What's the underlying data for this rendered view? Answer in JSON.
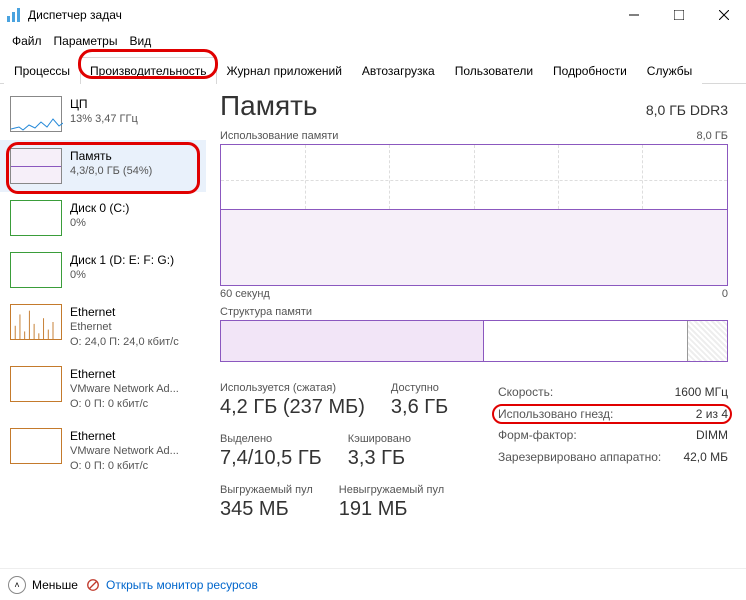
{
  "window": {
    "title": "Диспетчер задач"
  },
  "menu": {
    "file": "Файл",
    "options": "Параметры",
    "view": "Вид"
  },
  "tabs": {
    "processes": "Процессы",
    "performance": "Производительность",
    "apphistory": "Журнал приложений",
    "startup": "Автозагрузка",
    "users": "Пользователи",
    "details": "Подробности",
    "services": "Службы"
  },
  "sidebar": {
    "cpu": {
      "title": "ЦП",
      "detail": "13%  3,47 ГГц"
    },
    "memory": {
      "title": "Память",
      "detail": "4,3/8,0 ГБ (54%)"
    },
    "disk0": {
      "title": "Диск 0 (C:)",
      "detail": "0%"
    },
    "disk1": {
      "title": "Диск 1 (D: E: F: G:)",
      "detail": "0%"
    },
    "eth0": {
      "title": "Ethernet",
      "sub": "Ethernet",
      "detail": "О: 24,0 П: 24,0 кбит/с"
    },
    "eth1": {
      "title": "Ethernet",
      "sub": "VMware Network Ad...",
      "detail": "О: 0 П: 0 кбит/с"
    },
    "eth2": {
      "title": "Ethernet",
      "sub": "VMware Network Ad...",
      "detail": "О: 0 П: 0 кбит/с"
    }
  },
  "main": {
    "title": "Память",
    "spec": "8,0 ГБ DDR3",
    "usage_label": "Использование памяти",
    "usage_max": "8,0 ГБ",
    "x_left": "60 секунд",
    "x_right": "0",
    "comp_label": "Структура памяти",
    "stats": {
      "in_use_label": "Используется (сжатая)",
      "in_use": "4,2 ГБ (237 МБ)",
      "avail_label": "Доступно",
      "avail": "3,6 ГБ",
      "commit_label": "Выделено",
      "commit": "7,4/10,5 ГБ",
      "cached_label": "Кэшировано",
      "cached": "3,3 ГБ",
      "paged_label": "Выгружаемый пул",
      "paged": "345 МБ",
      "nonpaged_label": "Невыгружаемый пул",
      "nonpaged": "191 МБ"
    },
    "spectable": {
      "speed_k": "Скорость:",
      "speed_v": "1600 МГц",
      "slots_k": "Использовано гнезд:",
      "slots_v": "2 из 4",
      "form_k": "Форм-фактор:",
      "form_v": "DIMM",
      "hw_k": "Зарезервировано аппаратно:",
      "hw_v": "42,0 МБ"
    }
  },
  "footer": {
    "fewer": "Меньше",
    "resmon": "Открыть монитор ресурсов"
  },
  "chart_data": {
    "type": "area",
    "title": "Использование памяти",
    "xlabel": "60 секунд",
    "ylabel": "",
    "x": [
      0,
      60
    ],
    "ylim": [
      0,
      8.0
    ],
    "series": [
      {
        "name": "Используется",
        "values": [
          4.3,
          4.3
        ]
      }
    ]
  }
}
